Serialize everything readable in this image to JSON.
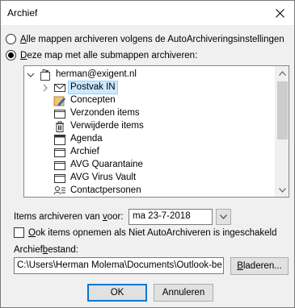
{
  "window": {
    "title": "Archief"
  },
  "options": {
    "archive_all": {
      "prefix": "",
      "accel": "A",
      "rest": "lle mappen archiveren volgens de AutoArchiveringsinstellingen",
      "checked": false
    },
    "archive_folder": {
      "prefix": "",
      "accel": "D",
      "rest": "eze map met alle submappen archiveren:",
      "checked": true
    }
  },
  "tree": {
    "items": [
      {
        "label": "herman@exigent.nl",
        "icon": "mailbox-icon",
        "expander": "expanded-chevron"
      },
      {
        "label": "Postvak IN",
        "icon": "envelope-icon",
        "expander": "collapsed-chevron",
        "selected": true
      },
      {
        "label": "Concepten",
        "icon": "drafts-icon"
      },
      {
        "label": "Verzonden items",
        "icon": "folder-icon"
      },
      {
        "label": "Verwijderde items",
        "icon": "trash-icon"
      },
      {
        "label": "Agenda",
        "icon": "calendar-icon"
      },
      {
        "label": "Archief",
        "icon": "folder-icon"
      },
      {
        "label": "AVG Quarantaine",
        "icon": "folder-icon"
      },
      {
        "label": "AVG Virus Vault",
        "icon": "folder-icon"
      },
      {
        "label": "Contactpersonen",
        "icon": "contacts-icon"
      }
    ]
  },
  "date": {
    "prefix": "Items archiveren van ",
    "accel": "v",
    "rest": "oor:",
    "value": "ma 23-7-2018"
  },
  "include_checkbox": {
    "prefix": "",
    "accel": "O",
    "rest": "ok items opnemen als Niet AutoArchiveren is ingeschakeld",
    "checked": false
  },
  "file": {
    "prefix": "Archief",
    "accel": "b",
    "rest": "estand:",
    "value": "C:\\Users\\Herman Molema\\Documents\\Outlook-be"
  },
  "buttons": {
    "browse": {
      "prefix": "",
      "accel": "B",
      "rest": "laderen..."
    },
    "ok": "OK",
    "cancel": "Annuleren"
  }
}
